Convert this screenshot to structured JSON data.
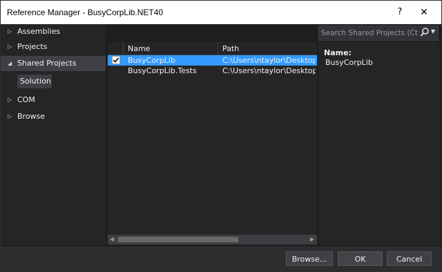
{
  "window": {
    "title": "Reference Manager - BusyCorpLib.NET40",
    "help_label": "?",
    "close_label": "✕"
  },
  "nav": {
    "items": [
      {
        "label": "Assemblies",
        "expanded": false
      },
      {
        "label": "Projects",
        "expanded": false
      },
      {
        "label": "Shared Projects",
        "expanded": true,
        "selected": true
      },
      {
        "label": "COM",
        "expanded": false
      },
      {
        "label": "Browse",
        "expanded": false
      }
    ],
    "sub_item": "Solution"
  },
  "search": {
    "placeholder": "Search Shared Projects (Ctrl+E)"
  },
  "grid": {
    "columns": [
      "Name",
      "Path"
    ],
    "rows": [
      {
        "checked": true,
        "name": "BusyCorpLib",
        "path": "C:\\Users\\ntaylor\\Desktop\\Bus",
        "selected": true
      },
      {
        "checked": false,
        "name": "BusyCorpLib.Tests",
        "path": "C:\\Users\\ntaylor\\Desktop\\Bus",
        "selected": false
      }
    ]
  },
  "details": {
    "name_label": "Name:",
    "name_value": "BusyCorpLib"
  },
  "footer": {
    "browse_label": "Browse...",
    "ok_label": "OK",
    "cancel_label": "Cancel"
  },
  "colors": {
    "selection": "#3399ff",
    "background": "#1e1e1e",
    "panel": "#252526"
  }
}
